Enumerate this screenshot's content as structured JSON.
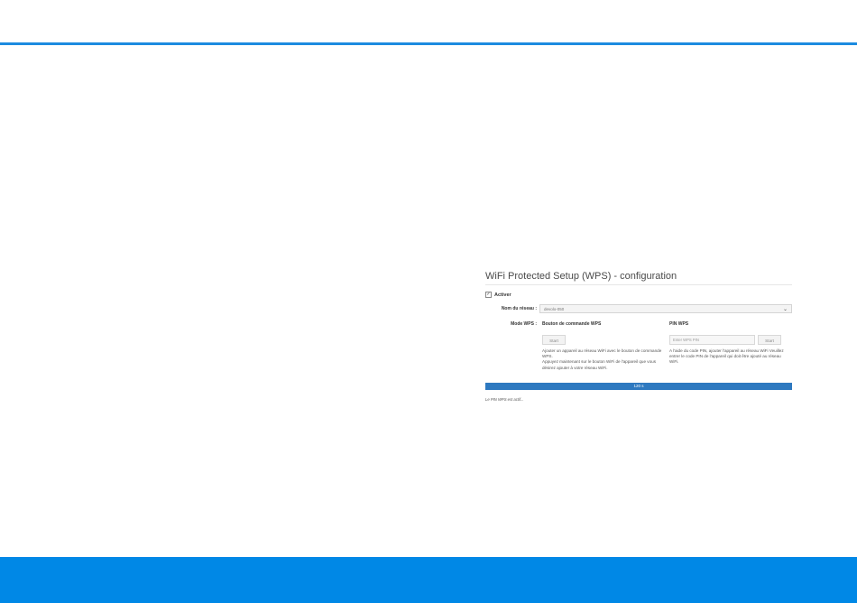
{
  "colors": {
    "accent": "#1c8be0",
    "footer": "#0088e6",
    "progress": "#2e79c0"
  },
  "wps": {
    "title": "WiFi Protected Setup (WPS) - configuration",
    "activate_label": "Activer",
    "activate_checked": true,
    "network_label": "Nom du réseau :",
    "network_value": "devolo-050",
    "mode_label": "Mode WPS :",
    "push": {
      "heading": "Bouton de commande WPS",
      "button_label": "Start",
      "desc1": "Ajouter un appareil au réseau WiFi avec le bouton de commande WPS.",
      "desc2": "Appuyez maintenant sur le bouton WiFi de l'appareil que vous désirez ajouter à votre réseau WiFi."
    },
    "pin": {
      "heading": "PIN WPS",
      "placeholder": "Enter WPS PIN",
      "button_label": "Start",
      "desc": "A l'aide du code PIN, ajouter l'appareil au réseau WiFi Veuillez entrer le code PIN de l'appareil qui doit être ajouté au réseau WiFi."
    },
    "progress_label": "120 s",
    "progress_fraction": 1.0,
    "status": "Le PIN WPS est actif..."
  }
}
